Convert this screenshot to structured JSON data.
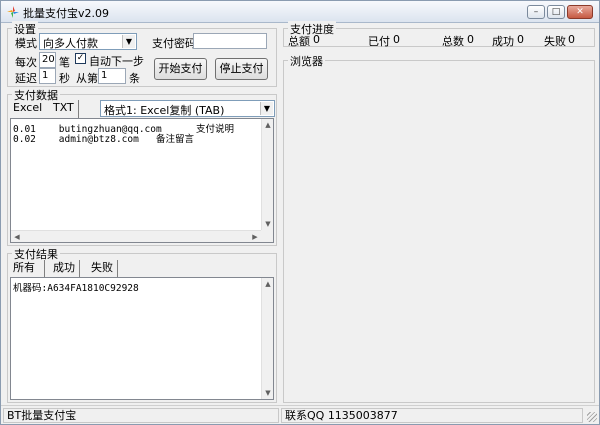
{
  "window": {
    "title": "批量支付宝v2.09",
    "controls": {
      "minimize": "–",
      "maximize": "□",
      "close": "✕"
    }
  },
  "settings": {
    "group_label": "设置",
    "mode_label": "模式",
    "mode_value": "向多人付款",
    "pay_password_label": "支付密码",
    "pay_password_value": "",
    "each_label": "每次",
    "each_value": "20",
    "each_unit": "笔",
    "auto_next_label": "自动下一步",
    "auto_next_checked": "✓",
    "delay_label": "延迟",
    "delay_value": "1",
    "delay_unit": "秒",
    "from_label": "从第",
    "from_value": "1",
    "from_unit": "条",
    "start_button": "开始支付",
    "stop_button": "停止支付"
  },
  "pay_data": {
    "group_label": "支付数据",
    "tabs": [
      "Excel",
      "TXT"
    ],
    "format_value": "格式1: Excel复制 (TAB)",
    "rows": [
      "0.01    butingzhuan@qq.com      支付说明",
      "0.02    admin@btz8.com   备注留言"
    ]
  },
  "pay_result": {
    "group_label": "支付结果",
    "tabs": [
      "所有",
      "成功",
      "失败"
    ],
    "lines": [
      "机器码:A634FA1810C92928"
    ]
  },
  "progress": {
    "group_label": "支付进度",
    "total_label": "总额",
    "total_value": "0",
    "paid_label": "已付",
    "paid_value": "0",
    "count_label": "总数",
    "count_value": "0",
    "success_label": "成功",
    "success_value": "0",
    "fail_label": "失败",
    "fail_value": "0"
  },
  "browser": {
    "group_label": "浏览器"
  },
  "statusbar": {
    "left": "BT批量支付宝",
    "right": "联系QQ 1135003877"
  },
  "scroll_glyphs": {
    "up": "▲",
    "down": "▼",
    "left": "◀",
    "right": "▶"
  },
  "colors": {
    "title_gradient_top": "#f7f9fc",
    "title_gradient_bottom": "#dbe4ef",
    "close_button": "#c65a42"
  }
}
